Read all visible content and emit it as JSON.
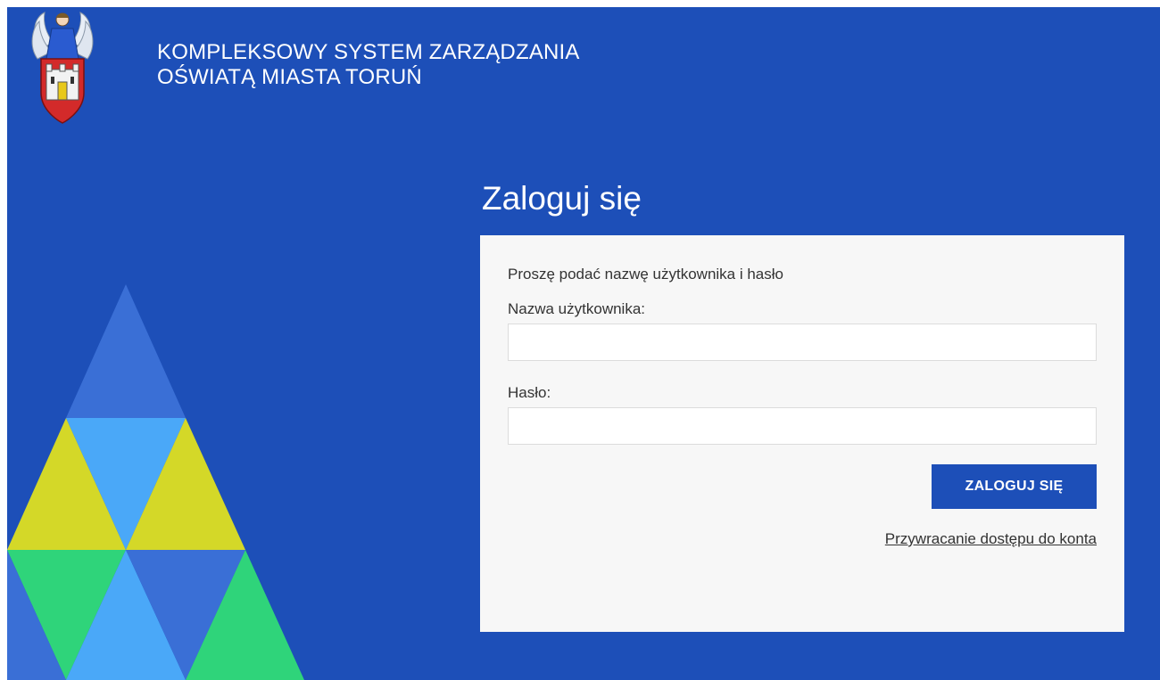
{
  "header": {
    "title_line1": "KOMPLEKSOWY SYSTEM ZARZĄDZANIA",
    "title_line2": "OŚWIATĄ MIASTA TORUŃ",
    "logo_icon": "torun-coat-of-arms-icon"
  },
  "login": {
    "heading": "Zaloguj się",
    "prompt": "Proszę podać nazwę użytkownika i hasło",
    "username_label": "Nazwa użytkownika:",
    "username_value": "",
    "password_label": "Hasło:",
    "password_value": "",
    "submit_label": "ZALOGUJ SIĘ",
    "recover_link": "Przywracanie dostępu do konta"
  },
  "colors": {
    "background": "#1d4fb8",
    "panel": "#f7f7f7",
    "button": "#1d4fb8",
    "triangle_blue": "#3a6fd6",
    "triangle_light_blue": "#4aa8f8",
    "triangle_yellow": "#d4d828",
    "triangle_green": "#2fd47a"
  }
}
